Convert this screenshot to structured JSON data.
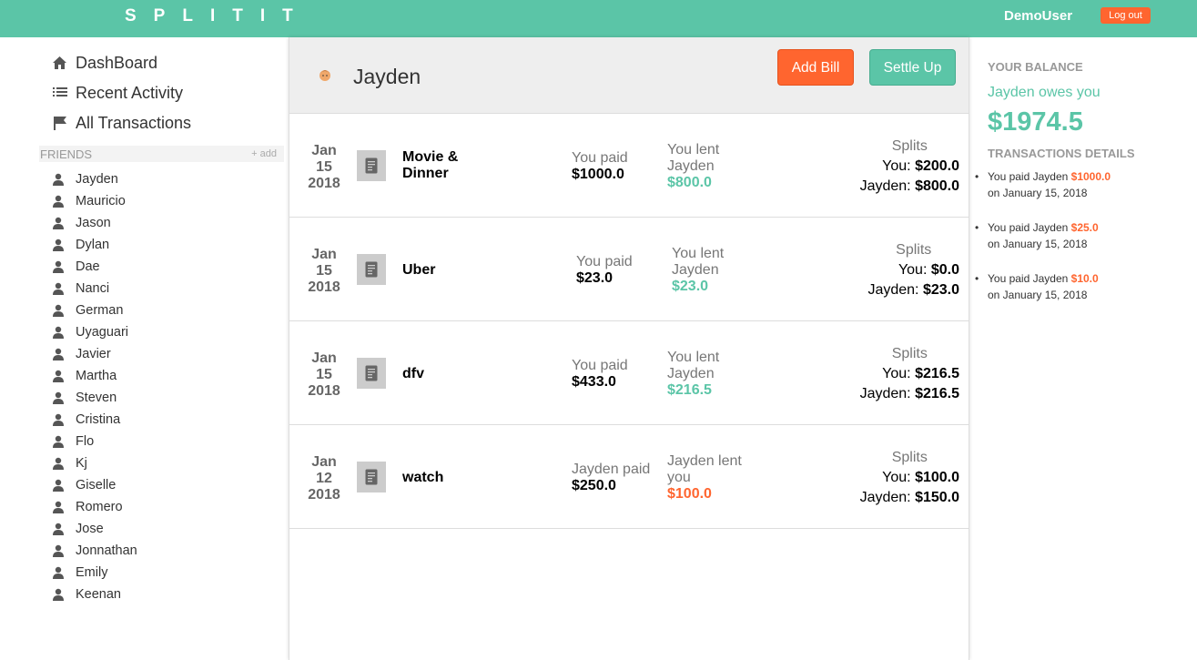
{
  "app": {
    "logo": "SPLITIT",
    "username": "DemoUser",
    "logout_label": "Log out"
  },
  "nav": [
    {
      "label": "DashBoard",
      "icon": "home-icon"
    },
    {
      "label": "Recent Activity",
      "icon": "list-icon"
    },
    {
      "label": "All Transactions",
      "icon": "flag-icon"
    }
  ],
  "friends": {
    "title": "FRIENDS",
    "add_label": "+ add",
    "items": [
      "Jayden",
      "Mauricio",
      "Jason",
      "Dylan",
      "Dae",
      "Nanci",
      "German",
      "Uyaguari",
      "Javier",
      "Martha",
      "Steven",
      "Cristina",
      "Flo",
      "Kj",
      "Giselle",
      "Romero",
      "Jose",
      "Jonnathan",
      "Emily",
      "Keenan"
    ]
  },
  "main": {
    "friend_name": "Jayden",
    "add_bill_label": "Add Bill",
    "settle_up_label": "Settle Up",
    "bills": [
      {
        "month": "Jan",
        "day": "15",
        "year": "2018",
        "desc": "Movie & Dinner",
        "paid_label": "You paid",
        "paid_amount": "$1000.0",
        "lent_label": "You lent Jayden",
        "lent_amount": "$800.0",
        "lent_color": "green",
        "splits_title": "Splits",
        "split_you_label": "You:",
        "split_you": "$200.0",
        "split_friend_label": "Jayden:",
        "split_friend": "$800.0"
      },
      {
        "month": "Jan",
        "day": "15",
        "year": "2018",
        "desc": "Uber",
        "paid_label": "You paid",
        "paid_amount": "$23.0",
        "lent_label": "You lent Jayden",
        "lent_amount": "$23.0",
        "lent_color": "green",
        "splits_title": "Splits",
        "split_you_label": "You:",
        "split_you": "$0.0",
        "split_friend_label": "Jayden:",
        "split_friend": "$23.0"
      },
      {
        "month": "Jan",
        "day": "15",
        "year": "2018",
        "desc": "dfv",
        "paid_label": "You paid",
        "paid_amount": "$433.0",
        "lent_label": "You lent Jayden",
        "lent_amount": "$216.5",
        "lent_color": "green",
        "splits_title": "Splits",
        "split_you_label": "You:",
        "split_you": "$216.5",
        "split_friend_label": "Jayden:",
        "split_friend": "$216.5"
      },
      {
        "month": "Jan",
        "day": "12",
        "year": "2018",
        "desc": "watch",
        "paid_label": "Jayden paid",
        "paid_amount": "$250.0",
        "lent_label": "Jayden lent you",
        "lent_amount": "$100.0",
        "lent_color": "orange",
        "splits_title": "Splits",
        "split_you_label": "You:",
        "split_you": "$100.0",
        "split_friend_label": "Jayden:",
        "split_friend": "$150.0"
      }
    ]
  },
  "balance": {
    "title": "YOUR BALANCE",
    "owes_text": "Jayden owes you",
    "amount": "$1974.5",
    "tx_title": "TRANSACTIONS DETAILS",
    "transactions": [
      {
        "prefix": "You paid Jayden",
        "amount": "$1000.0",
        "date": "on January 15, 2018"
      },
      {
        "prefix": "You paid Jayden",
        "amount": "$25.0",
        "date": "on January 15, 2018"
      },
      {
        "prefix": "You paid Jayden",
        "amount": "$10.0",
        "date": "on January 15, 2018"
      }
    ]
  },
  "colors": {
    "brand": "#5bc5a7",
    "accent": "#ff652f"
  }
}
